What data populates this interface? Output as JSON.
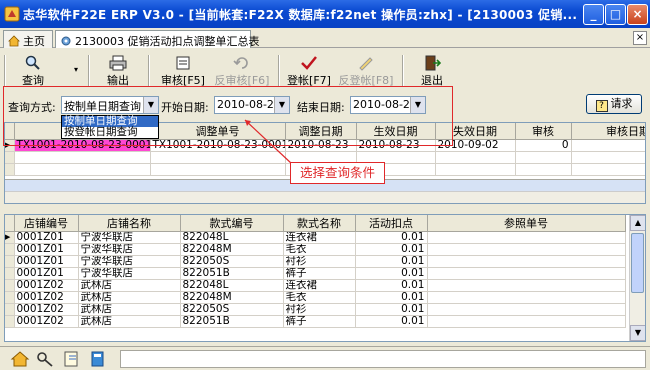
{
  "window": {
    "title": "志华软件F22E ERP V3.0  - [当前帐套:F22X 数据库:f22net 操作员:zhx] - [2130003 促销...",
    "min": "_",
    "max": "□",
    "close": "×"
  },
  "tabs": [
    {
      "label": "主页"
    },
    {
      "label": "2130003 促销活动扣点调整单汇总表"
    }
  ],
  "tab_close": "×",
  "toolbar": {
    "query": "查询",
    "output": "输出",
    "audit": "审核[F5]",
    "unaudit": "反审核[F6]",
    "post": "登帐[F7]",
    "unpost": "反登帐[F8]",
    "exit": "退出"
  },
  "query_panel": {
    "mode_label": "查询方式:",
    "mode_value": "按制单日期查询",
    "start_label": "开始日期:",
    "start_value": "2010-08-23",
    "end_label": "结束日期:",
    "end_value": "2010-08-23",
    "request": "请求"
  },
  "mode_options": [
    "按制单日期查询",
    "按登帐日期查询"
  ],
  "annotation": "选择查询条件",
  "top_grid": {
    "columns": [
      "单号",
      "调整单号",
      "调整日期",
      "生效日期",
      "失效日期",
      "审核",
      "审核日期"
    ],
    "rows": [
      [
        "TX1001-2010-08-23-0001",
        "TX1001-2010-08-23-0001",
        "2010-08-23",
        "2010-08-23",
        "2010-09-02",
        "0",
        ""
      ]
    ]
  },
  "bottom_grid": {
    "columns": [
      "店铺编号",
      "店铺名称",
      "款式编号",
      "款式名称",
      "活动扣点",
      "参照单号"
    ],
    "rows": [
      [
        "0001Z01",
        "宁波华联店",
        "822048L",
        "连衣裙",
        "0.01",
        ""
      ],
      [
        "0001Z01",
        "宁波华联店",
        "822048M",
        "毛衣",
        "0.01",
        ""
      ],
      [
        "0001Z01",
        "宁波华联店",
        "822050S",
        "衬衫",
        "0.01",
        ""
      ],
      [
        "0001Z01",
        "宁波华联店",
        "822051B",
        "裤子",
        "0.01",
        ""
      ],
      [
        "0001Z02",
        "武林店",
        "822048L",
        "连衣裙",
        "0.01",
        ""
      ],
      [
        "0001Z02",
        "武林店",
        "822048M",
        "毛衣",
        "0.01",
        ""
      ],
      [
        "0001Z02",
        "武林店",
        "822050S",
        "衬衫",
        "0.01",
        ""
      ],
      [
        "0001Z02",
        "武林店",
        "822051B",
        "裤子",
        "0.01",
        ""
      ]
    ]
  },
  "icons": [
    "home-icon",
    "settings-icon",
    "search-icon",
    "printer-icon",
    "stamp-icon",
    "check-icon",
    "exit-door-icon",
    "question-icon",
    "key-icon",
    "note-icon",
    "book-icon"
  ],
  "colors": {
    "titlebar": "#0a4ad1",
    "highlight_row": "#ff47d3",
    "annotation": "#e0282a",
    "selection": "#316ac5"
  }
}
